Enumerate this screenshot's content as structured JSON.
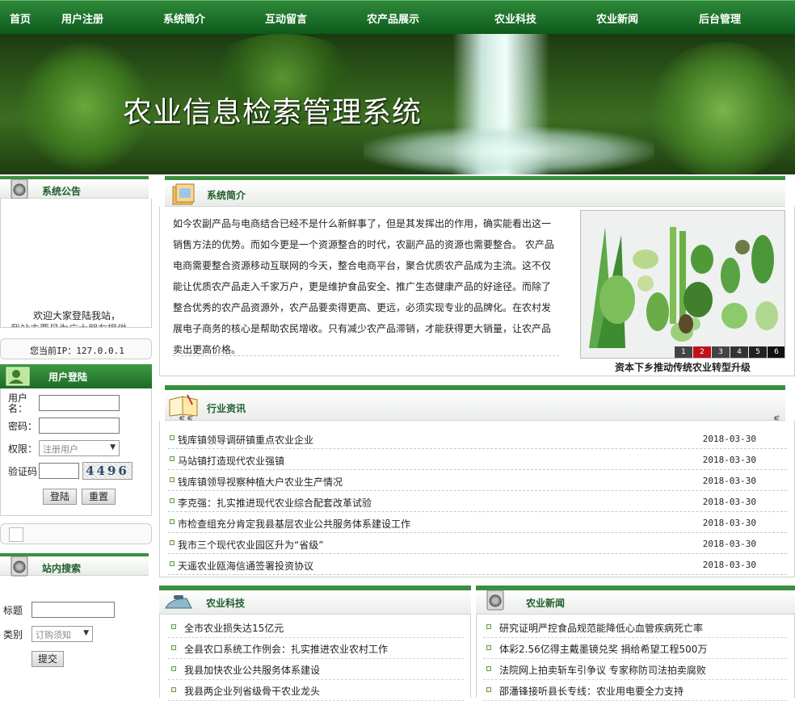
{
  "nav": [
    "首页",
    "用户注册",
    "系统简介",
    "互动留言",
    "农产品展示",
    "农业科技",
    "农业新闻",
    "后台管理"
  ],
  "banner": {
    "title": "农业信息检索管理系统"
  },
  "notice": {
    "title": "系统公告",
    "line1": "欢迎大家登陆我站，",
    "line2": "我站主要是为广大朋友提供..."
  },
  "ip": {
    "label": "您当前IP：127.0.0.1"
  },
  "login": {
    "title": "用户登陆",
    "username_label": "用户名：",
    "password_label": "密码：",
    "role_label": "权限：",
    "role_value": "注册用户",
    "captcha_label": "验证码",
    "captcha_text": "4496",
    "login_button": "登陆",
    "reset_button": "重置"
  },
  "search": {
    "title": "站内搜索",
    "title_label": "标题",
    "category_label": "类别",
    "category_value": "订购须知",
    "submit_button": "提交"
  },
  "intro": {
    "title": "系统简介",
    "text": "如今农副产品与电商结合已经不是什么新鲜事了，但是其发挥出的作用，确实能看出这一销售方法的优势。而如今更是一个资源整合的时代，农副产品的资源也需要整合。 农产品电商需要整合资源移动互联网的今天，整合电商平台，聚合优质农产品成为主流。这不仅能让优质农产品走入千家万户，更是维护食品安全、推广生态健康产品的好途径。而除了整合优秀的农产品资源外，农产品要卖得更高、更远，必须实现专业的品牌化。在农村发展电子商务的核心是帮助农民增收。只有减少农产品滞销，才能获得更大销量，让农产品卖出更高价格。",
    "image_caption": "资本下乡推动传统农业转型升级",
    "slide_numbers": [
      "1",
      "2",
      "3",
      "4",
      "5",
      "6"
    ],
    "active_slide": "2"
  },
  "industry": {
    "title": "行业资讯",
    "items": [
      {
        "title": "钱库镇领导调研镇重点农业企业",
        "date": "2018-03-30"
      },
      {
        "title": "马站镇打造现代农业强镇",
        "date": "2018-03-30"
      },
      {
        "title": "钱库镇领导视察种植大户农业生产情况",
        "date": "2018-03-30"
      },
      {
        "title": "李克强：扎实推进现代农业综合配套改革试验",
        "date": "2018-03-30"
      },
      {
        "title": "市检查组充分肯定我县基层农业公共服务体系建设工作",
        "date": "2018-03-30"
      },
      {
        "title": "我市三个现代农业园区升为“省级”",
        "date": "2018-03-30"
      },
      {
        "title": "天遥农业瓯海信通签署投资协议",
        "date": "2018-03-30"
      }
    ]
  },
  "tech": {
    "title": "农业科技",
    "items": [
      "全市农业损失达15亿元",
      "全县农口系统工作例会：扎实推进农业农村工作",
      "我县加快农业公共服务体系建设",
      "我县两企业列省级骨干农业龙头"
    ]
  },
  "agnews": {
    "title": "农业新闻",
    "items": [
      "研究证明严控食品规范能降低心血管疾病死亡率",
      "体彩2.56亿得主戴墨镜兑奖 捐给希望工程500万",
      "法院网上拍卖斩车引争议 专家称防司法拍卖腐败",
      "邵潘锋接听县长专线：农业用电要全力支持"
    ]
  },
  "colors": {
    "nav_green": "#1c6b26",
    "accent": "#3a8f3f"
  }
}
